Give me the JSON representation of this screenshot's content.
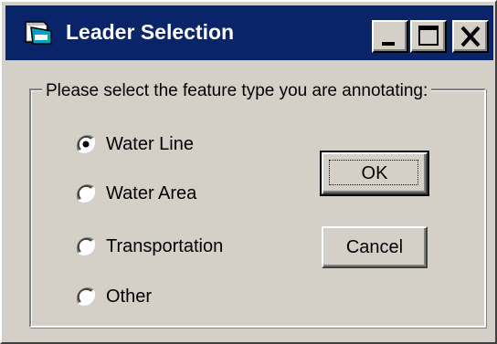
{
  "window": {
    "title": "Leader Selection",
    "icon": "application-window-icon",
    "controls": [
      "minimize-icon",
      "maximize-icon",
      "close-icon"
    ]
  },
  "group": {
    "label": "Please select the feature type you are annotating:"
  },
  "options": [
    {
      "label": "Water Line",
      "selected": true
    },
    {
      "label": "Water Area",
      "selected": false
    },
    {
      "label": "Transportation",
      "selected": false
    },
    {
      "label": "Other",
      "selected": false
    }
  ],
  "buttons": {
    "ok_label": "OK",
    "cancel_label": "Cancel"
  },
  "colors": {
    "titlebar": "#0a246a",
    "face": "#d4d0c8"
  }
}
